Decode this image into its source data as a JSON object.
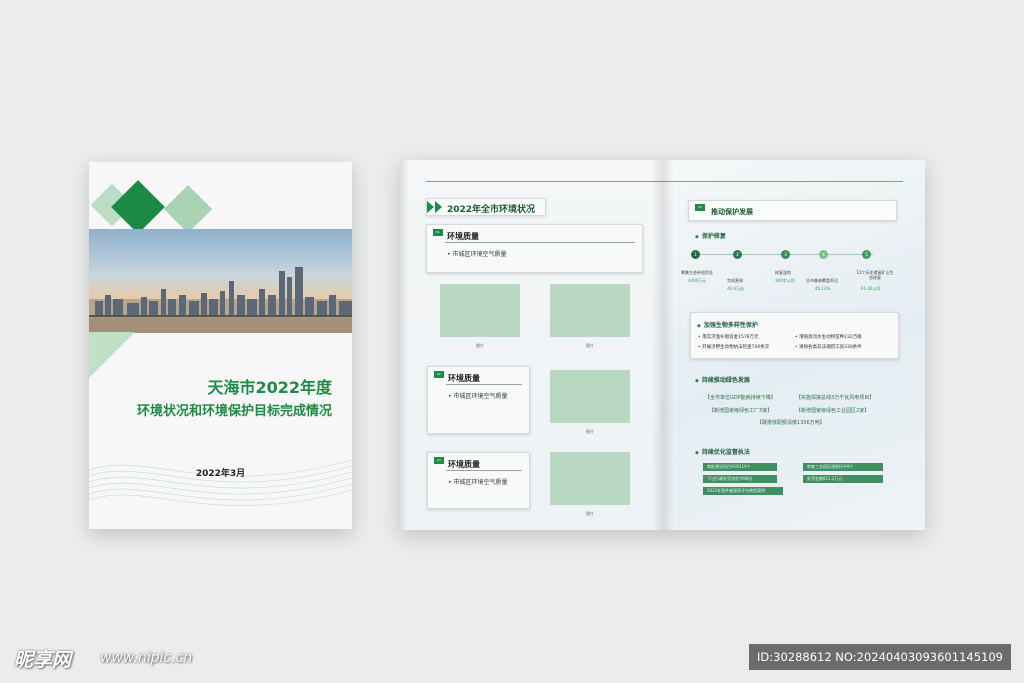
{
  "cover": {
    "title_line1": "天海市2022年度",
    "title_line2": "环境状况和环境保护目标完成情况",
    "date": "2022年3月"
  },
  "left_page": {
    "section_title": "2022年全市环境状况",
    "cards": [
      {
        "tag": "01",
        "title": "环境质量",
        "item": "市城区环境空气质量"
      },
      {
        "tag": "02",
        "title": "环境质量",
        "item": "市城区环境空气质量"
      },
      {
        "tag": "03",
        "title": "环境质量",
        "item": "市城区环境空气质量"
      }
    ],
    "placeholder_caption": "图片"
  },
  "right_page": {
    "section_tag": "03",
    "section_title": "推动保护发展",
    "sub1": {
      "title": "保护修复",
      "steps": [
        "1",
        "2",
        "3",
        "4",
        "5"
      ],
      "labels": [
        "筹集生态补偿资金",
        "完成营林",
        "修复湿地",
        "全市森林覆盖率达",
        "12个历史遗留矿山生态修复"
      ],
      "values": [
        "4400万元",
        "46.9万亩",
        "300余公顷",
        "46.13%",
        "61.46公顷"
      ]
    },
    "sub2": {
      "title": "加强生物多样性保护",
      "items": [
        "落实济渔补偿资金1578万元",
        "增殖放流水生动物苗种232万尾",
        "开展涉野生动物执法检查700余次",
        "清除各类非法捕捞工具330余件"
      ]
    },
    "sub3": {
      "title": "持续推动绿色发展",
      "items": [
        "全市单位GDP能耗持续下降",
        "实施焊接总线3万千瓦风电项目",
        "新增国家级绿色工厂3家",
        "新增国家级绿色工业园区2家",
        "碳排放配额清缴1356万吨"
      ]
    },
    "sub4": {
      "title": "持续优化监督执法",
      "items": [
        "审批建设项目环评119个",
        "审查工业园区规划环评9个",
        "下达行政处罚决定书98份",
        "处罚金额815.2万元",
        "2022年案件被国家评为典型案例"
      ]
    }
  },
  "watermark": {
    "logo": "昵享网",
    "url": "www.nipic.cn",
    "id": "ID:30288612 NO:20240403093601145109"
  }
}
